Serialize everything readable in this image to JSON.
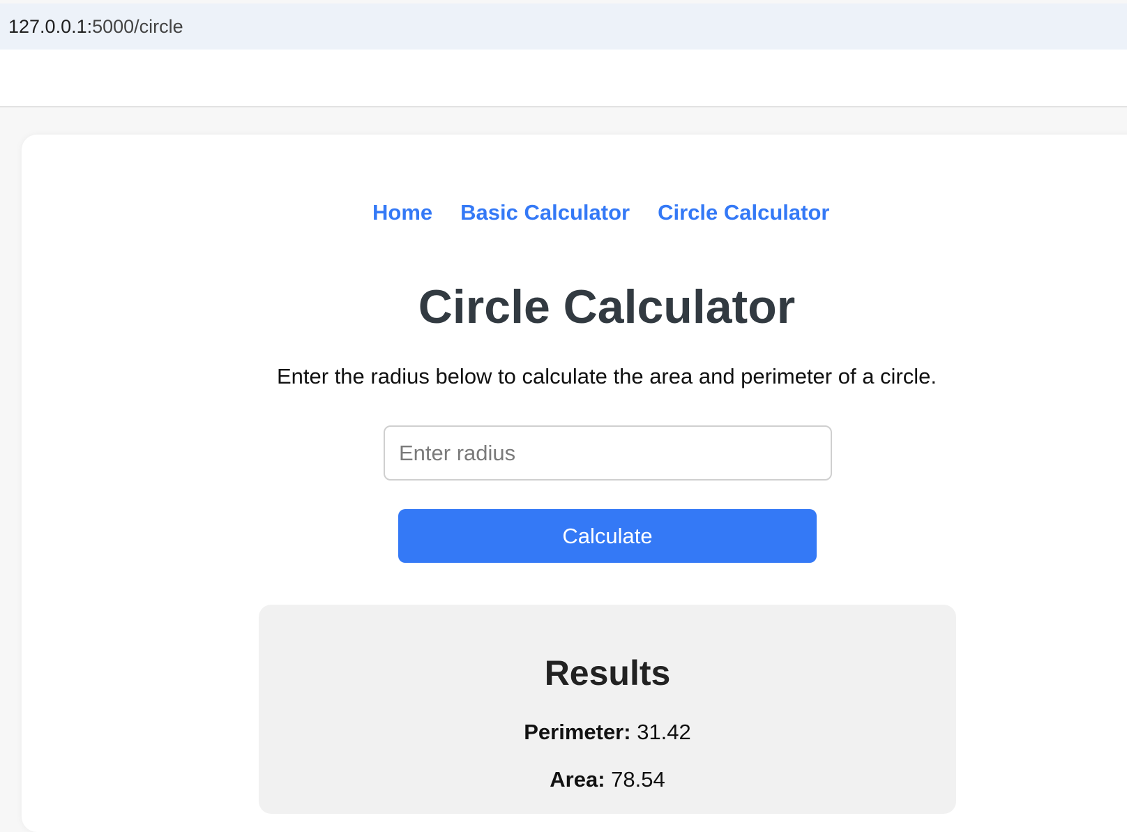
{
  "browser": {
    "url_host": "127.0.0.1:",
    "url_rest": "5000/circle"
  },
  "nav": {
    "items": [
      {
        "label": "Home"
      },
      {
        "label": "Basic Calculator"
      },
      {
        "label": "Circle Calculator"
      }
    ]
  },
  "main": {
    "title": "Circle Calculator",
    "intro": "Enter the radius below to calculate the area and perimeter of a circle.",
    "radius_input": {
      "value": "",
      "placeholder": "Enter radius"
    },
    "calculate_label": "Calculate"
  },
  "results": {
    "title": "Results",
    "perimeter_label": "Perimeter:",
    "perimeter_value": "31.42",
    "area_label": "Area:",
    "area_value": "78.54"
  },
  "colors": {
    "accent": "#3479f6",
    "title": "#323a41",
    "results_bg": "#f1f1f1"
  }
}
